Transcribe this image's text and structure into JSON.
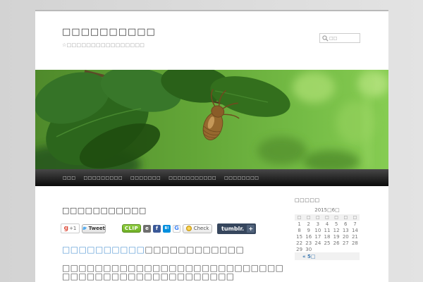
{
  "header": {
    "site_title": "□□□□□□□□□□",
    "site_subtitle": "☆□□□□□□□□□□□□□□□□",
    "search": {
      "placeholder": "□□",
      "icon": "magnifier-icon"
    }
  },
  "banner": {
    "description": "cicada exuvia (empty cicada shell) hanging under green leaves, blurred green background"
  },
  "nav": {
    "items": [
      "□□□",
      "□□□□□□□□□",
      "□□□□□□□",
      "□□□□□□□□□□□",
      "□□□□□□□□"
    ]
  },
  "article": {
    "title": "□□□□□□□□□□□",
    "share": {
      "gplus": {
        "g": "g",
        "count": "+1"
      },
      "tweet": {
        "label": "Tweet"
      },
      "clip": {
        "label": "CLIP"
      },
      "hatena": {
        "label": "B!"
      },
      "gbookmark": {
        "label": "G"
      },
      "check": {
        "label": "Check"
      },
      "tumblr": {
        "label": "tumblr.",
        "plus": "+"
      },
      "icons": [
        "evernote-icon",
        "facebook-icon",
        "hatena-bookmark-icon",
        "google-bookmark-icon"
      ]
    },
    "lead": {
      "link_text": "□□□□□□□□□□",
      "rest_text": "□□□□□□□□□□□□"
    },
    "paragraph": {
      "line1": "□□□□□□□□□□□□□□□□□□□□□□□□□□□",
      "line2": "□□□□□□□□□□□□□□□□□□□□□"
    }
  },
  "sidebar": {
    "widget_title": "□□□□□",
    "calendar": {
      "caption": "2015□6□",
      "weekdays": [
        "□",
        "□",
        "□",
        "□",
        "□",
        "□",
        "□"
      ],
      "weeks": [
        [
          "1",
          "2",
          "3",
          "4",
          "5",
          "6",
          "7"
        ],
        [
          "8",
          "9",
          "10",
          "11",
          "12",
          "13",
          "14"
        ],
        [
          "15",
          "16",
          "17",
          "18",
          "19",
          "20",
          "21"
        ],
        [
          "22",
          "23",
          "24",
          "25",
          "26",
          "27",
          "28"
        ],
        [
          "29",
          "30",
          "",
          "",
          "",
          "",
          ""
        ]
      ],
      "prev_link": "« 5□"
    }
  },
  "colors": {
    "page_background": "#d9d9d9",
    "content_background": "#ffffff",
    "nav_background": "#111111",
    "link_blue": "#5b9bd5",
    "calendar_link_blue": "#3b78b0",
    "gplus_red": "#dd4b39",
    "twitter_blue": "#55acee",
    "clip_green": "#7bbf33",
    "facebook_blue": "#3b5998",
    "hatena_blue": "#008fde",
    "check_gold": "#e8b416",
    "tumblr_navy": "#36465d"
  }
}
